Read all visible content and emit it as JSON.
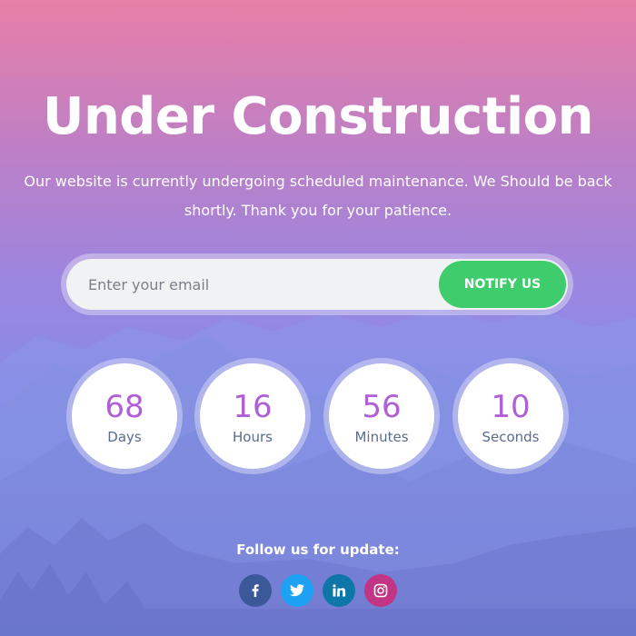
{
  "hero": {
    "title": "Under Construction",
    "subtitle": "Our website is currently undergoing scheduled maintenance. We Should be back shortly. Thank you for your patience."
  },
  "subscribe": {
    "placeholder": "Enter your email",
    "button_label": "NOTIFY US"
  },
  "countdown": [
    {
      "value": "68",
      "label": "Days"
    },
    {
      "value": "16",
      "label": "Hours"
    },
    {
      "value": "56",
      "label": "Minutes"
    },
    {
      "value": "10",
      "label": "Seconds"
    }
  ],
  "social": {
    "heading": "Follow us for update:",
    "links": [
      {
        "icon": "facebook-icon",
        "color": "#3b5998"
      },
      {
        "icon": "twitter-icon",
        "color": "#1da1f2"
      },
      {
        "icon": "linkedin-icon",
        "color": "#0e76a8"
      },
      {
        "icon": "instagram-icon",
        "color": "#c13584"
      }
    ]
  },
  "colors": {
    "accent_green": "#3fcc6c",
    "number_purple": "#b05fd6"
  }
}
